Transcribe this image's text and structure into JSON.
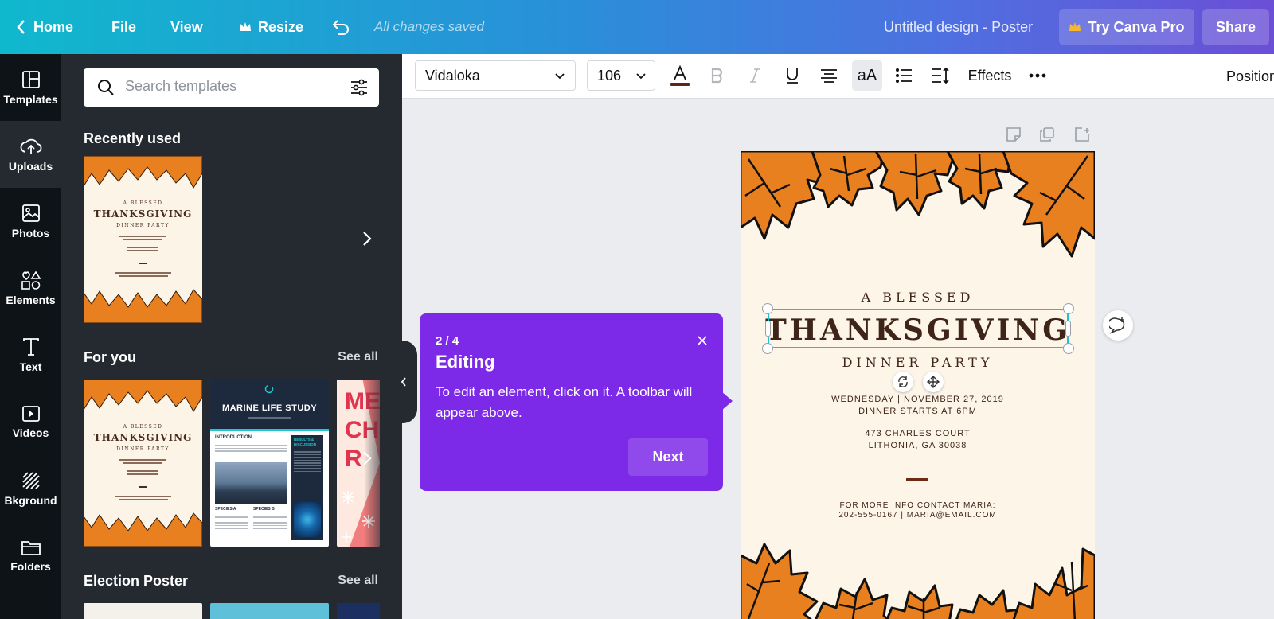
{
  "topbar": {
    "home": "Home",
    "file": "File",
    "view": "View",
    "resize": "Resize",
    "saved_status": "All changes saved",
    "document_title": "Untitled design - Poster",
    "try_pro": "Try Canva Pro",
    "share": "Share",
    "pro_crown_color": "#f5b82e"
  },
  "rail": {
    "items": [
      {
        "label": "Templates",
        "icon": "templates-icon"
      },
      {
        "label": "Uploads",
        "icon": "upload-cloud-icon"
      },
      {
        "label": "Photos",
        "icon": "photo-icon"
      },
      {
        "label": "Elements",
        "icon": "shapes-icon"
      },
      {
        "label": "Text",
        "icon": "text-icon"
      },
      {
        "label": "Videos",
        "icon": "video-icon"
      },
      {
        "label": "Bkground",
        "icon": "background-icon"
      },
      {
        "label": "Folders",
        "icon": "folder-icon"
      }
    ]
  },
  "panel": {
    "search_placeholder": "Search templates",
    "recently_used": "Recently used",
    "for_you": "For you",
    "election_poster": "Election Poster",
    "see_all": "See all",
    "thumb_thanks": {
      "l1": "A BLESSED",
      "l2": "THANKSGIVING",
      "l3": "DINNER PARTY"
    },
    "thumb_marine": {
      "title": "MARINE LIFE STUDY",
      "intro": "INTRODUCTION",
      "results": "RESULTS & DISCUSSION",
      "species_a": "SPECIES A",
      "species_b": "SPECIES B"
    },
    "thumb_christmas": {
      "text": "ME CHR"
    }
  },
  "toolbar": {
    "font": "Vidaloka",
    "size": "106",
    "effects": "Effects",
    "position": "Position",
    "text_color": "#5a2a12"
  },
  "poster": {
    "line1": "A BLESSED",
    "line2": "THANKSGIVING",
    "line3": "DINNER PARTY",
    "date": "WEDNESDAY | NOVEMBER 27, 2019",
    "time": "DINNER STARTS AT 6PM",
    "address1": "473 CHARLES COURT",
    "address2": "LITHONIA, GA 30038",
    "info1": "FOR MORE INFO CONTACT MARIA:",
    "info2": "202-555-0167 | MARIA@EMAIL.COM",
    "leaf_color": "#e9801f",
    "text_color": "#3e2419"
  },
  "tooltip": {
    "step": "2 / 4",
    "title": "Editing",
    "body": "To edit an element, click on it. A toolbar will appear above.",
    "next": "Next",
    "bg_color": "#7d2ae8"
  },
  "selection_color": "#19c3d3"
}
